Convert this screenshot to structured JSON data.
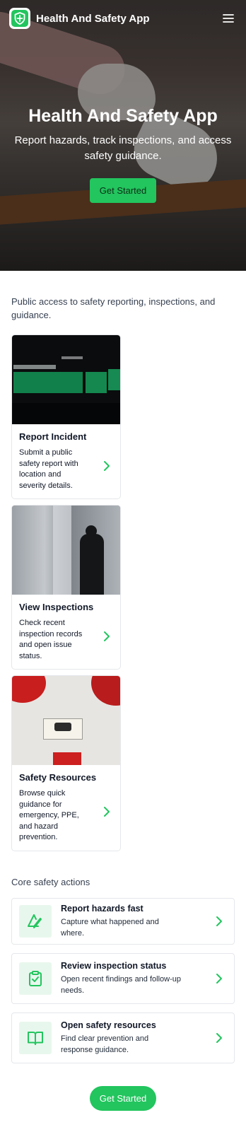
{
  "app": {
    "brand": "Health And Safety App",
    "icons": {
      "logo": "shield-plus-icon",
      "menu": "hamburger-menu-icon"
    }
  },
  "hero": {
    "title": "Health And Safety App",
    "subtitle": "Report hazards, track inspections, and access safety guidance.",
    "cta_label": "Get Started"
  },
  "intro": {
    "text": "Public access to safety reporting, inspections, and guidance."
  },
  "cards": [
    {
      "title": "Report Incident",
      "text": "Submit a public safety report with location and severity details."
    },
    {
      "title": "View Inspections",
      "text": "Check recent inspection records and open issue status."
    },
    {
      "title": "Safety Resources",
      "text": "Browse quick guidance for emergency, PPE, and hazard prevention."
    }
  ],
  "core": {
    "heading": "Core safety actions",
    "items": [
      {
        "title": "Report hazards fast",
        "text": "Capture what happened and where.",
        "icon": "hazard-triangle-pen-icon"
      },
      {
        "title": "Review inspection status",
        "text": "Open recent findings and follow-up needs.",
        "icon": "clipboard-check-icon"
      },
      {
        "title": "Open safety resources",
        "text": "Find clear prevention and response guidance.",
        "icon": "open-book-icon"
      }
    ]
  },
  "footer": {
    "cta_label": "Get Started"
  },
  "colors": {
    "accent": "#22c55e",
    "accent_light": "#e8f7ed",
    "text": "#111827"
  }
}
